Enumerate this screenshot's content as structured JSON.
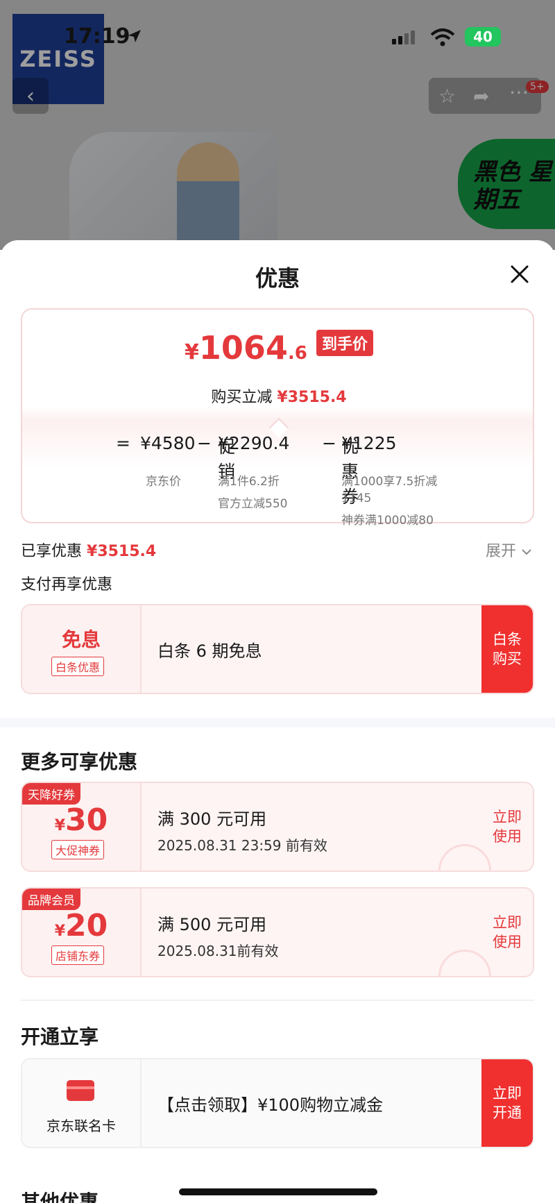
{
  "status_bar": {
    "time": "17:19",
    "battery": "40"
  },
  "brand": {
    "logo_text": "ZEISS"
  },
  "nav": {
    "badge": "5+"
  },
  "promo": {
    "tag": "黑色 星期五"
  },
  "sheet": {
    "title": "优惠"
  },
  "price": {
    "yen": "¥",
    "integer": "1064",
    "decimal": ".6",
    "final_badge": "到手价",
    "buy_reduce_label": "购买立减",
    "buy_reduce_value": "¥3515.4",
    "equation": {
      "eq": "=",
      "jd_price": "¥4580",
      "minus1": "−",
      "promo_label": "促销",
      "promo_value": "¥2290.4",
      "minus2": "−",
      "coupon_label": "优惠券",
      "coupon_value": "¥1225"
    },
    "jd_price_label": "京东价",
    "promo_details": [
      "满1件6.2折",
      "官方立减550"
    ],
    "coupon_details": [
      "满1000享7.5折减",
      "1145",
      "神券满1000减80"
    ]
  },
  "enjoyed": {
    "label": "已享优惠",
    "value": "¥3515.4",
    "expand": "展开"
  },
  "pay_more": {
    "label": "支付再享优惠"
  },
  "baitiao": {
    "title": "免息",
    "tag": "白条优惠",
    "desc": "白条 6 期免息",
    "button_line1": "白条",
    "button_line2": "购买"
  },
  "more": {
    "heading": "更多可享优惠",
    "coupons": [
      {
        "corner": "天降好券",
        "yen": "¥",
        "amount": "30",
        "tag": "大促神券",
        "condition": "满 300 元可用",
        "validity": "2025.08.31 23:59 前有效",
        "action_line1": "立即",
        "action_line2": "使用"
      },
      {
        "corner": "品牌会员",
        "yen": "¥",
        "amount": "20",
        "tag": "店铺东券",
        "condition": "满 500 元可用",
        "validity": "2025.08.31前有效",
        "action_line1": "立即",
        "action_line2": "使用"
      }
    ]
  },
  "open": {
    "heading": "开通立享",
    "card_label": "京东联名卡",
    "desc": "【点击领取】¥100购物立减金",
    "button_line1": "立即",
    "button_line2": "开通"
  },
  "other": {
    "heading": "其他优惠"
  }
}
